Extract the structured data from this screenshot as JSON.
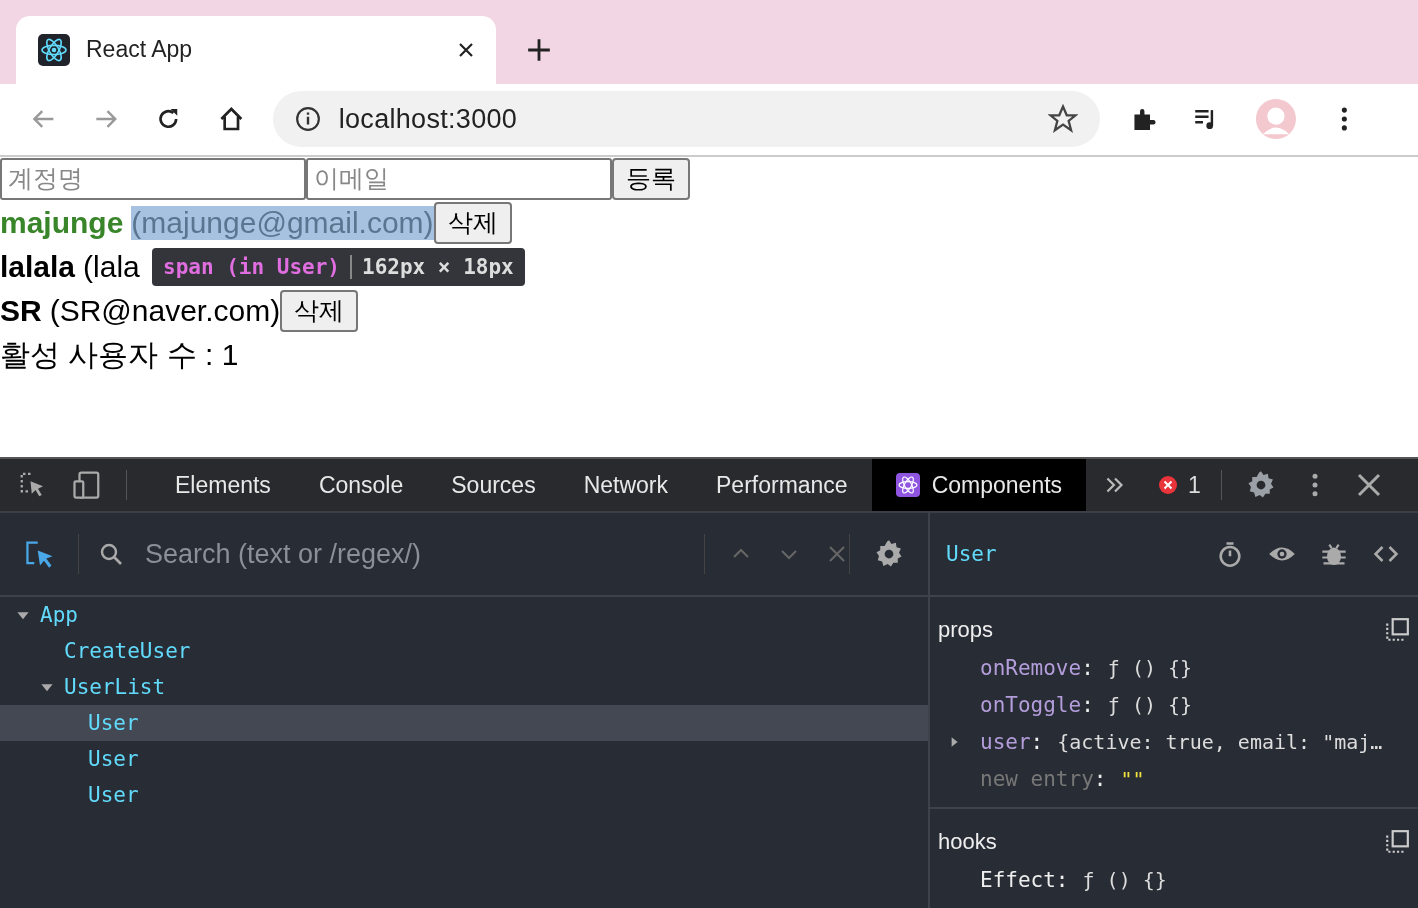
{
  "browser": {
    "tab_title": "React App",
    "url": "localhost:3000"
  },
  "form": {
    "name_placeholder": "계정명",
    "email_placeholder": "이메일",
    "submit": "등록"
  },
  "users": [
    {
      "name": "majunge",
      "email": "(majunge@gmail.com)",
      "active": true,
      "selected": true,
      "button": "삭제"
    },
    {
      "name": "lalala",
      "email": "(lala",
      "active": false,
      "selected": false
    },
    {
      "name": "SR",
      "email": "(SR@naver.com)",
      "active": false,
      "selected": false,
      "button": "삭제"
    }
  ],
  "active_count": "활성 사용자 수 : 1",
  "tooltip": {
    "element": "span (in User)",
    "size": "162px × 18px"
  },
  "devtools": {
    "tabs": [
      {
        "label": "Elements",
        "selected": false
      },
      {
        "label": "Console",
        "selected": false
      },
      {
        "label": "Sources",
        "selected": false
      },
      {
        "label": "Network",
        "selected": false
      },
      {
        "label": "Performance",
        "selected": false
      },
      {
        "label": "Components",
        "selected": true
      }
    ],
    "error_count": "1",
    "search_placeholder": "Search (text or /regex/)",
    "tree": [
      {
        "name": "App",
        "expanded": true,
        "selected": false,
        "children": [
          {
            "name": "CreateUser",
            "selected": false
          },
          {
            "name": "UserList",
            "expanded": true,
            "selected": false,
            "children": [
              {
                "name": "User",
                "selected": true
              },
              {
                "name": "User",
                "selected": false
              },
              {
                "name": "User",
                "selected": false
              }
            ]
          }
        ]
      }
    ],
    "inspected": "User",
    "separator": ":",
    "props_title": "props",
    "props": [
      {
        "key": "onRemove",
        "value": "ƒ () {}",
        "kind": "prop"
      },
      {
        "key": "onToggle",
        "value": "ƒ () {}",
        "kind": "prop"
      },
      {
        "key": "user",
        "value": "{active: true, email: \"maj…",
        "kind": "object"
      },
      {
        "key": "new entry",
        "value": "\"\"",
        "kind": "new"
      }
    ],
    "hooks_title": "hooks",
    "hooks": [
      {
        "key": "Effect",
        "value": "ƒ () {}"
      }
    ]
  }
}
